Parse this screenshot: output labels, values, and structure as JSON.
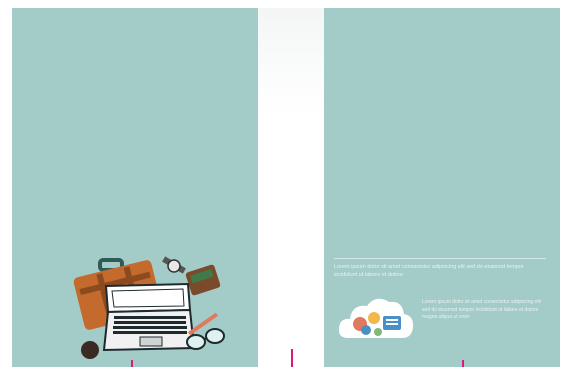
{
  "document": {
    "spread": "two-page layout preview",
    "colors": {
      "page": "#a3ccc8",
      "crop_mark": "#d81b78",
      "briefcase": "#c46a2c",
      "laptop": "#ffffff"
    }
  },
  "left_page": {
    "illustration": "travel-laptop-briefcase-illustration"
  },
  "right_page": {
    "caption": "Lorem ipsum dolor sit amet consectetur adipiscing elit sed do eiusmod tempor incididunt ut labore et dolore",
    "body": "Lorem ipsum dolor sit amet consectetur adipiscing elit sed do eiusmod tempor incididunt ut labore et dolore magna aliqua ut enim",
    "illustration": "cloud-network-icon"
  }
}
